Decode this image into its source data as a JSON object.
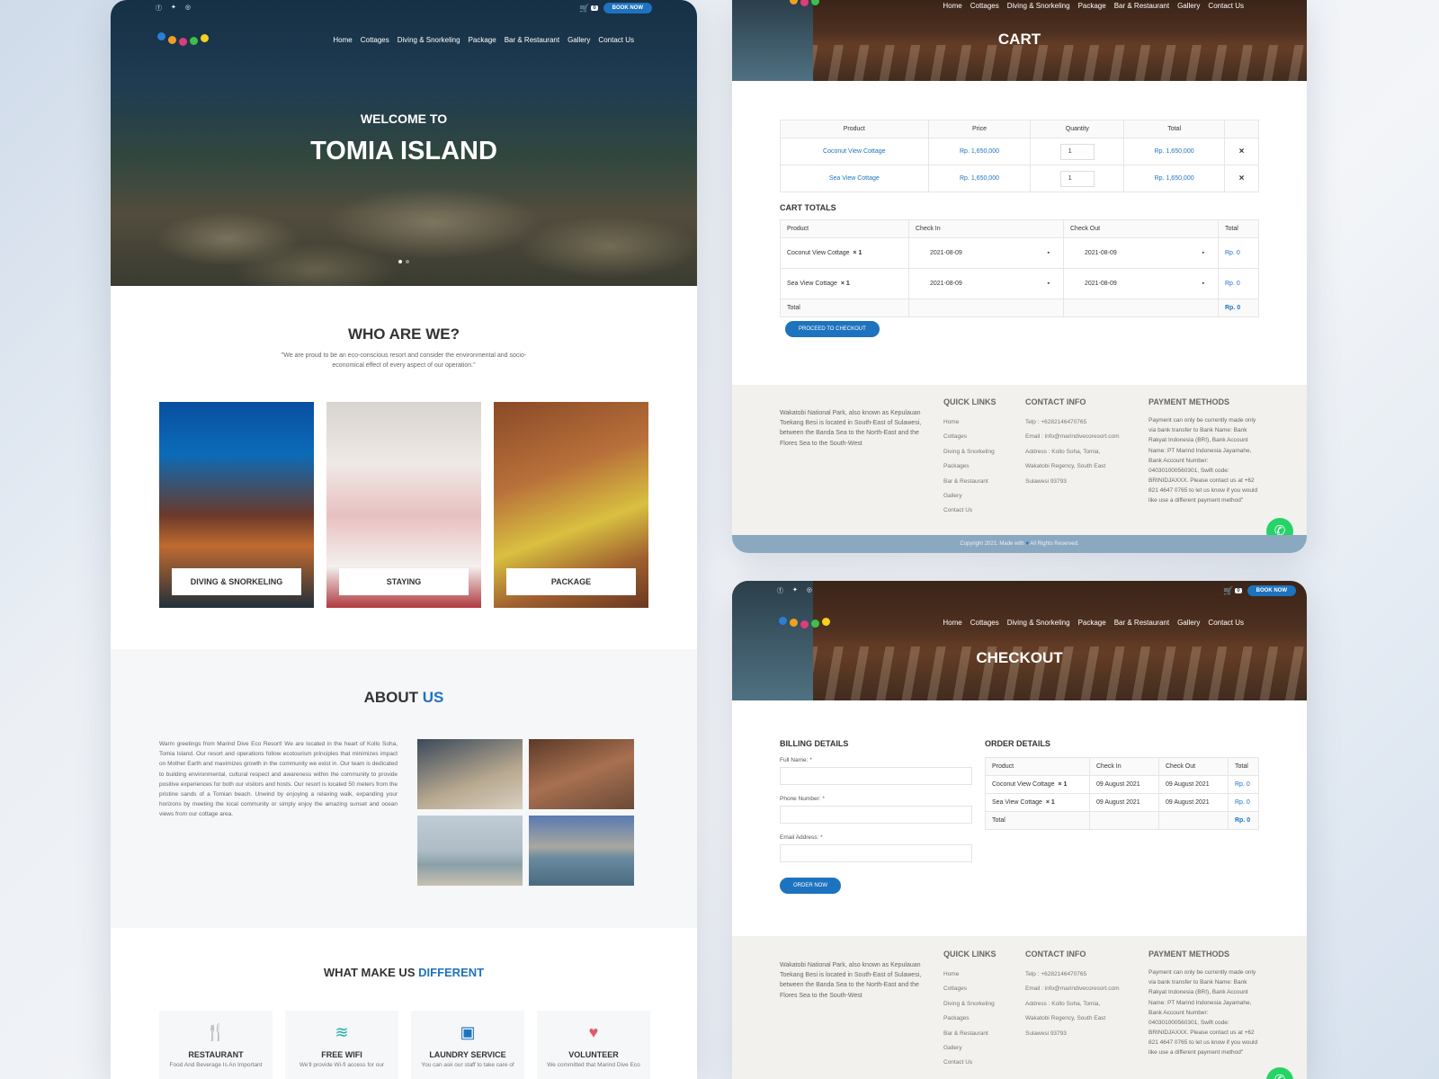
{
  "site": {
    "social_icons": [
      "facebook-icon",
      "twitter-icon",
      "instagram-icon"
    ],
    "cart_count": "0",
    "book_now": "BOOK NOW",
    "menu": [
      "Home",
      "Cottages",
      "Diving & Snorkeling",
      "Package",
      "Bar & Restaurant",
      "Gallery",
      "Contact Us"
    ]
  },
  "home": {
    "hero_small": "WELCOME TO",
    "hero_big": "TOMIA ISLAND",
    "who_title": "WHO ARE WE?",
    "who_text": "\"We are proud to be an eco-conscious resort and consider the environmental and socio-economical effect of every aspect of our operation.\"",
    "cards": [
      "DIVING & SNORKELING",
      "STAYING",
      "PACKAGE"
    ],
    "about_title_1": "ABOUT",
    "about_title_2": "US",
    "about_text": "Warm greetings from Marind Dive Eco Resort! We are located in the heart of Kollo Soha, Tomia Island. Our resort and operations follow ecotourism principles that minimizes impact on Mother Earth and maximizes growth in the community we exist in. Our team is dedicated to building environmental, cultural respect and awareness within the community to provide positive experiences for both our visitors and hosts. Our resort is located 50 meters from the pristine sands of a Tomian beach. Unwind by enjoying a relaxing walk, expanding your horizons by meeting the local community or simply enjoy the amazing sunset and ocean views from our cottage area.",
    "diff_title_1": "WHAT MAKE US",
    "diff_title_2": "DIFFERENT",
    "features": [
      {
        "title": "RESTAURANT",
        "desc": "Food And Beverage Is An Important",
        "icon": "utensils-icon"
      },
      {
        "title": "FREE WIFI",
        "desc": "We'll provide Wi-fi access for our",
        "icon": "wifi-icon"
      },
      {
        "title": "LAUNDRY SERVICE",
        "desc": "You can ask our staff to take care of",
        "icon": "washing-machine-icon"
      },
      {
        "title": "VOLUNTEER",
        "desc": "We committed that Marind Dive Eco",
        "icon": "volunteer-hands-icon"
      }
    ]
  },
  "cart": {
    "title": "CART",
    "headers": [
      "Product",
      "Price",
      "Quantity",
      "Total"
    ],
    "rows": [
      {
        "product": "Coconut View Cottage",
        "price": "Rp. 1,650,000",
        "qty": "1",
        "total": "Rp. 1,650,000",
        "remove": "×"
      },
      {
        "product": "Sea View Cottage",
        "price": "Rp. 1,650,000",
        "qty": "1",
        "total": "Rp. 1,650,000",
        "remove": "×"
      }
    ],
    "totals_title": "CART TOTALS",
    "totals_headers": [
      "Product",
      "Check In",
      "Check Out",
      "Total"
    ],
    "totals_rows": [
      {
        "product": "Coconut View Cottage",
        "mult": "× 1",
        "check_in": "2021-08-09",
        "check_out": "2021-08-09",
        "total": "Rp. 0"
      },
      {
        "product": "Sea View Cottage",
        "mult": "× 1",
        "check_in": "2021-08-09",
        "check_out": "2021-08-09",
        "total": "Rp. 0"
      }
    ],
    "total_label": "Total",
    "total_value": "Rp. 0",
    "checkout_btn": "PROCEED TO CHECKOUT"
  },
  "footer": {
    "about": "Wakatobi National Park, also known as Kepulauan Toekang Besi is located in South-East of Sulawesi, between the Banda Sea to the North-East and the Flores Sea to the South-West",
    "quick_title": "QUICK LINKS",
    "quick_links": [
      "Home",
      "Cottages",
      "Diving & Snorkeling",
      "Packages",
      "Bar & Restaurant",
      "Gallery",
      "Contact Us"
    ],
    "contact_title": "CONTACT INFO",
    "contact": [
      "Telp : +6282146470765",
      "Email : info@marindivecoresort.com",
      "Address : Kollo Soha, Tomia,",
      "Wakatobi Regency, South East",
      "Sulawesi 93793"
    ],
    "payment_title": "PAYMENT METHODS",
    "payment_text": "Payment can only be currently made only via bank transfer to Bank Name: Bank Rakyat Indonesia (BRI), Bank Account Name: PT Marind Indonesia Jayamahe, Bank Account Number: 040301000560301, Swift code: BRINIDJAXXX. Please contact us at +62 821 4647 0765 to let us know if you would like use a different payment method\"",
    "copyright_1": "Copyright 2021. Made with",
    "copyright_2": "All Rights Reserved."
  },
  "checkout": {
    "title": "CHECKOUT",
    "cart_count": "0",
    "billing_title": "BILLING DETAILS",
    "full_name_label": "Full Name:",
    "phone_label": "Phone Number:",
    "email_label": "Email Address:",
    "required": "*",
    "order_btn": "ORDER NOW",
    "order_title": "ORDER DETAILS",
    "order_headers": [
      "Product",
      "Check In",
      "Check Out",
      "Total"
    ],
    "order_rows": [
      {
        "product": "Coconut View Cottage",
        "mult": "× 1",
        "check_in": "09 August 2021",
        "check_out": "09 August 2021",
        "total": "Rp. 0"
      },
      {
        "product": "Sea View Cottage",
        "mult": "× 1",
        "check_in": "09 August 2021",
        "check_out": "09 August 2021",
        "total": "Rp. 0"
      }
    ],
    "total_label": "Total",
    "total_value": "Rp. 0"
  },
  "colors": {
    "accent": "#1e73be",
    "whatsapp": "#25d366",
    "footer_bg": "#f2f1ed"
  }
}
